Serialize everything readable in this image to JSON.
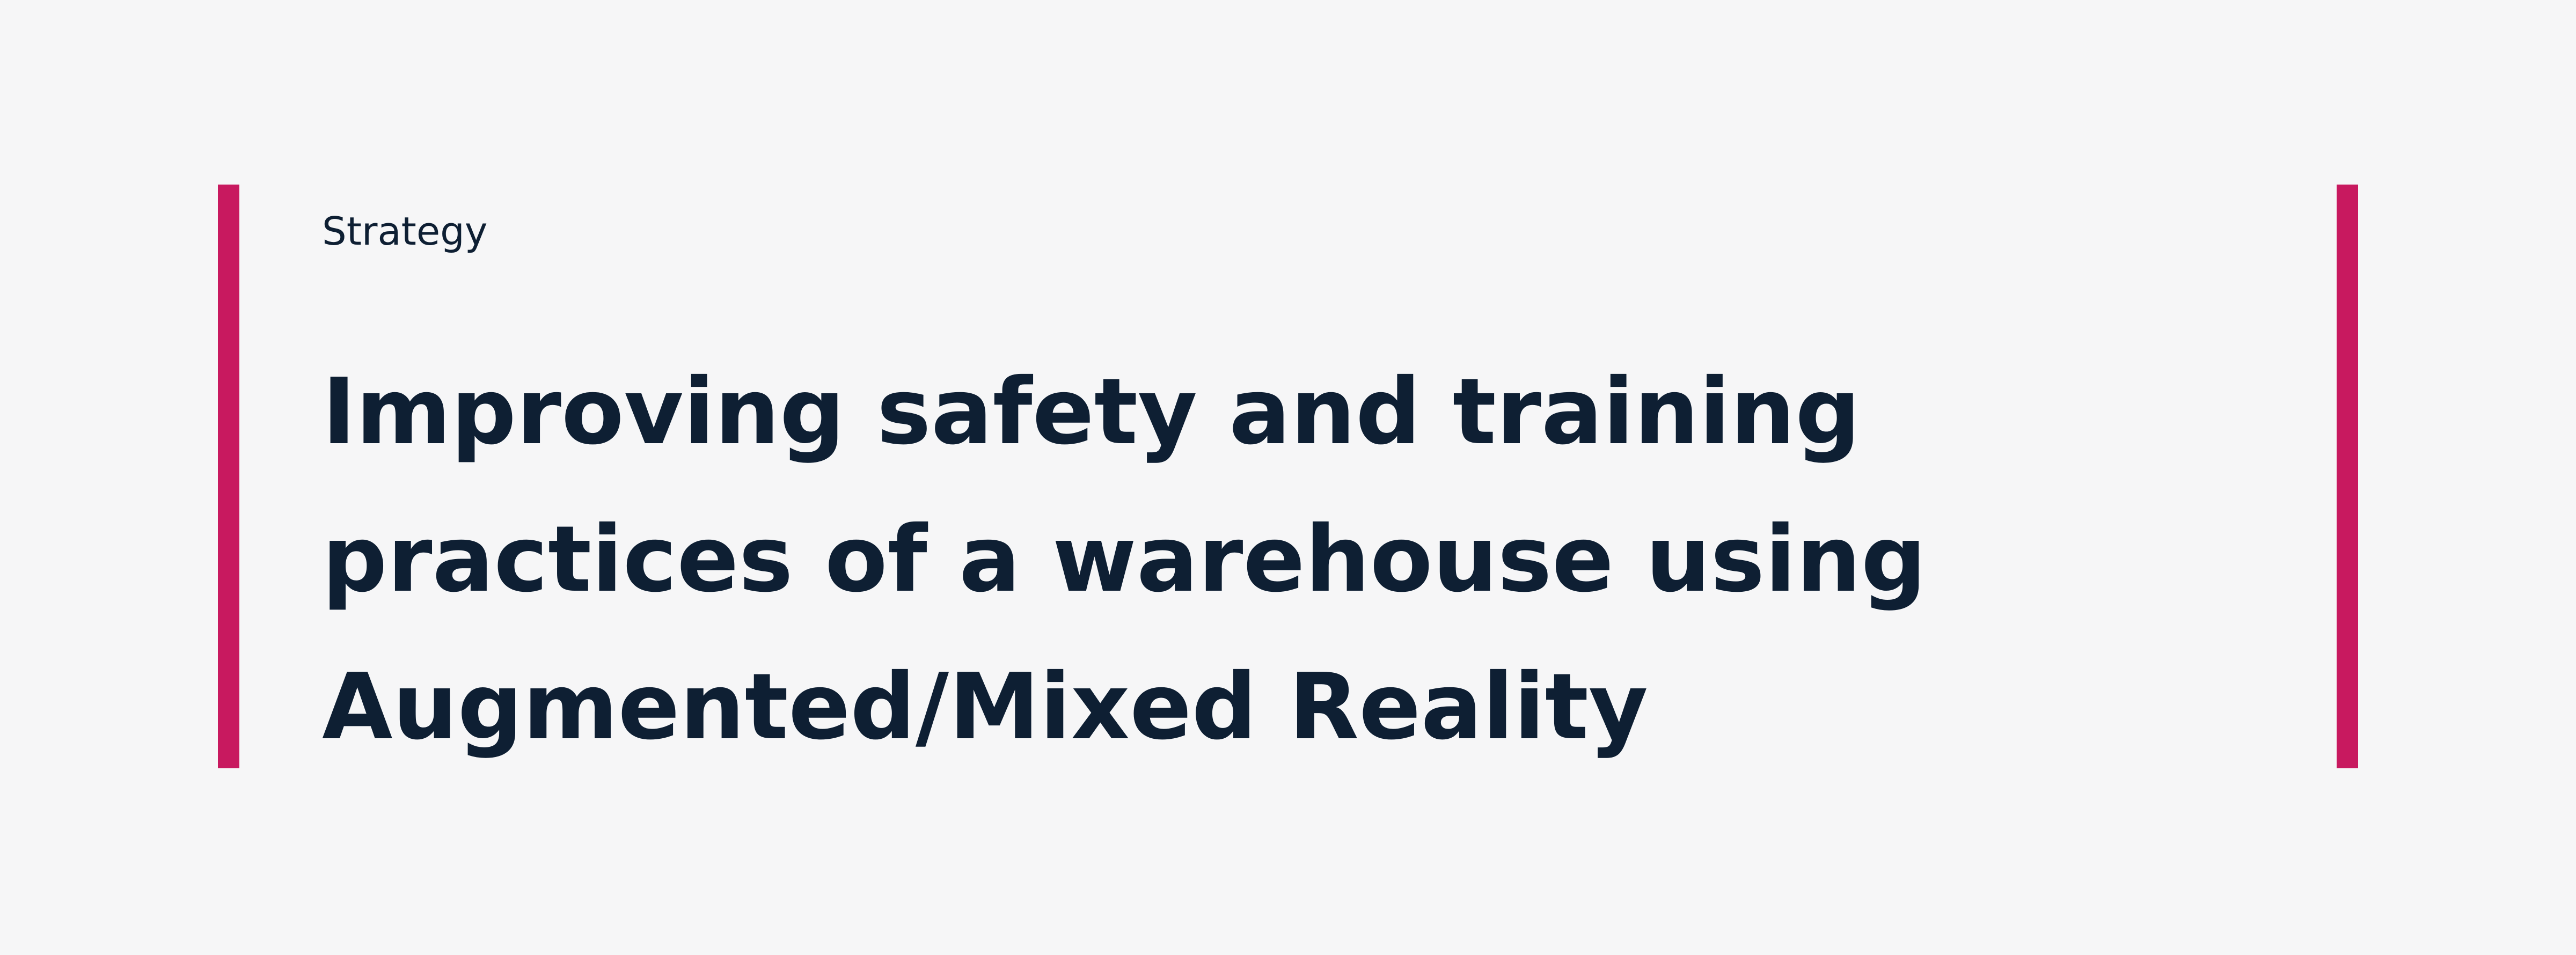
{
  "hero": {
    "category": "Strategy",
    "title": "Improving safety and training practices of a warehouse using Augmented/Mixed Reality"
  },
  "colors": {
    "background": "#f6f6f7",
    "accent": "#c8195f",
    "text": "#0e1f33"
  }
}
